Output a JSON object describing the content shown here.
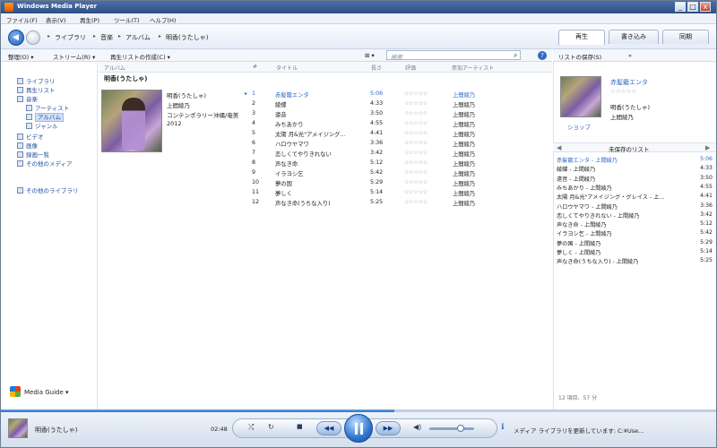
{
  "window": {
    "title": "Windows Media Player",
    "min": "_",
    "max": "□",
    "close": "x"
  },
  "menu": [
    "ファイル(F)",
    "表示(V)",
    "再生(P)",
    "ツール(T)",
    "ヘルプ(H)"
  ],
  "breadcrumb": [
    "ライブラリ",
    "音楽",
    "アルバム",
    "明香(うたしゃ)"
  ],
  "tabs": [
    {
      "label": "再生",
      "active": true
    },
    {
      "label": "書き込み",
      "active": false
    },
    {
      "label": "同期",
      "active": false
    }
  ],
  "toolbar": {
    "organize": "整理(O) ▾",
    "stream": "ストリーム(R) ▾",
    "create_playlist": "再生リストの作成(C) ▾",
    "view_icon": "⊞ ▾"
  },
  "search": {
    "placeholder": "検索"
  },
  "right_toolbar": {
    "save_list": "リストの保存(S)",
    "clear": "»"
  },
  "nav": {
    "items": [
      {
        "label": "ライブラリ",
        "indent": 0,
        "selected": false
      },
      {
        "label": "再生リスト",
        "indent": 0,
        "selected": false
      },
      {
        "label": "音楽",
        "indent": 0,
        "selected": false
      },
      {
        "label": "アーティスト",
        "indent": 1,
        "selected": false
      },
      {
        "label": "アルバム",
        "indent": 1,
        "selected": true
      },
      {
        "label": "ジャンル",
        "indent": 1,
        "selected": false
      },
      {
        "label": "ビデオ",
        "indent": 0,
        "selected": false
      },
      {
        "label": "画像",
        "indent": 0,
        "selected": false
      },
      {
        "label": "録画一覧",
        "indent": 0,
        "selected": false
      },
      {
        "label": "その他のメディア",
        "indent": 0,
        "selected": false
      }
    ],
    "other_libraries": "その他のライブラリ",
    "media_guide": "Media Guide ▾"
  },
  "columns": {
    "album": "アルバム",
    "num": "#",
    "title": "タイトル",
    "length": "長さ",
    "rating": "評価",
    "artist": "参加アーティスト"
  },
  "album": {
    "group_title": "明香(うたしゃ)",
    "info": [
      "明香(うたしゃ)",
      "上間綾乃",
      "コンテンポラリー沖縄/奄美",
      "2012"
    ]
  },
  "tracks": [
    {
      "num": "1",
      "title": "赤髪籠エンタ",
      "length": "5:06",
      "artist": "上間綾乃",
      "playing": true
    },
    {
      "num": "2",
      "title": "綾蝶",
      "length": "4:33",
      "artist": "上間綾乃",
      "playing": false
    },
    {
      "num": "3",
      "title": "遠音",
      "length": "3:50",
      "artist": "上間綾乃",
      "playing": false
    },
    {
      "num": "4",
      "title": "みちあかり",
      "length": "4:55",
      "artist": "上間綾乃",
      "playing": false
    },
    {
      "num": "5",
      "title": "太陽 月&光\"アメイジング…",
      "length": "4:41",
      "artist": "上間綾乃",
      "playing": false
    },
    {
      "num": "6",
      "title": "ハロウヤマワ",
      "length": "3:36",
      "artist": "上間綾乃",
      "playing": false
    },
    {
      "num": "7",
      "title": "恋しくてやりきれない",
      "length": "3:42",
      "artist": "上間綾乃",
      "playing": false
    },
    {
      "num": "8",
      "title": "声なき命",
      "length": "5:12",
      "artist": "上間綾乃",
      "playing": false
    },
    {
      "num": "9",
      "title": "イラヨシ乞",
      "length": "5:42",
      "artist": "上間綾乃",
      "playing": false
    },
    {
      "num": "10",
      "title": "夢の国",
      "length": "5:29",
      "artist": "上間綾乃",
      "playing": false
    },
    {
      "num": "11",
      "title": "夢しく",
      "length": "5:14",
      "artist": "上間綾乃",
      "playing": false
    },
    {
      "num": "12",
      "title": "声なき命(うちな入り)",
      "length": "5:25",
      "artist": "上間綾乃",
      "playing": false
    }
  ],
  "rating_stars": "☆☆☆☆☆",
  "now_playing_pane": {
    "title": "赤髪籠エンタ",
    "stars": "☆☆☆☆☆",
    "album": "明香(うたしゃ)",
    "artist": "上間綾乃",
    "shop": "ショップ",
    "list_header": "未保存のリスト",
    "items": [
      {
        "label": "赤髪籠エンタ - 上間綾乃",
        "length": "5:06",
        "playing": true
      },
      {
        "label": "綾蝶 - 上間綾乃",
        "length": "4:33",
        "playing": false
      },
      {
        "label": "遠音 - 上間綾乃",
        "length": "3:50",
        "playing": false
      },
      {
        "label": "みちあかり - 上間綾乃",
        "length": "4:55",
        "playing": false
      },
      {
        "label": "太陽 月&光\"アメイジング・グレイス - 上…",
        "length": "4:41",
        "playing": false
      },
      {
        "label": "ハロウヤマワ - 上間綾乃",
        "length": "3:36",
        "playing": false
      },
      {
        "label": "恋しくてやりきれない - 上間綾乃",
        "length": "3:42",
        "playing": false
      },
      {
        "label": "声なき命 - 上間綾乃",
        "length": "5:12",
        "playing": false
      },
      {
        "label": "イラヨシ乞 - 上間綾乃",
        "length": "5:42",
        "playing": false
      },
      {
        "label": "夢の国 - 上間綾乃",
        "length": "5:29",
        "playing": false
      },
      {
        "label": "夢しく - 上間綾乃",
        "length": "5:14",
        "playing": false
      },
      {
        "label": "声なき命(うちな入り) - 上間綾乃",
        "length": "5:25",
        "playing": false
      }
    ],
    "footer": "12 項目、57 分"
  },
  "player": {
    "now_playing": "明香(うたしゃ)",
    "time": "02:48",
    "progress": 0.55,
    "volume": 0.7,
    "status": "メディア ライブラリを更新しています: C:¥Use..."
  },
  "colors": {
    "accent": "#2f6ac4",
    "title_bar": "#2d4f86"
  }
}
